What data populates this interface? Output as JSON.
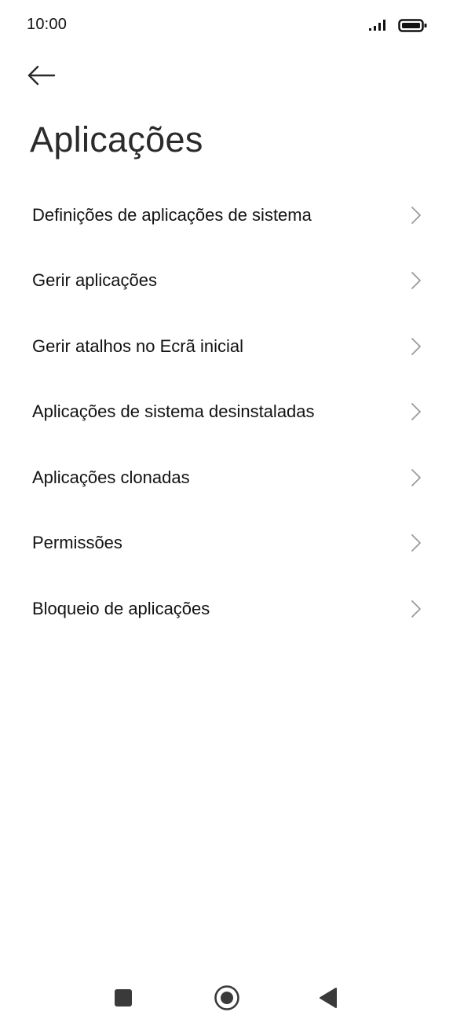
{
  "status_bar": {
    "time": "10:00",
    "icons": [
      "signal-icon",
      "battery-icon"
    ]
  },
  "header": {
    "back_icon": "arrow-left-icon",
    "title": "Aplicações"
  },
  "menu": {
    "items": [
      {
        "label": "Definições de aplicações de sistema"
      },
      {
        "label": "Gerir aplicações"
      },
      {
        "label": "Gerir atalhos no Ecrã inicial"
      },
      {
        "label": "Aplicações de sistema desinstaladas"
      },
      {
        "label": "Aplicações clonadas"
      },
      {
        "label": "Permissões"
      },
      {
        "label": "Bloqueio de aplicações"
      }
    ],
    "item_icon": "chevron-right-icon"
  },
  "nav_bar": {
    "icons": [
      "recents-square-icon",
      "home-circle-icon",
      "back-triangle-icon"
    ]
  },
  "colors": {
    "background": "#ffffff",
    "text_primary": "#121212",
    "title": "#2b2b2b",
    "chevron": "#9a9a9a",
    "nav_icon": "#3a3a3a"
  }
}
